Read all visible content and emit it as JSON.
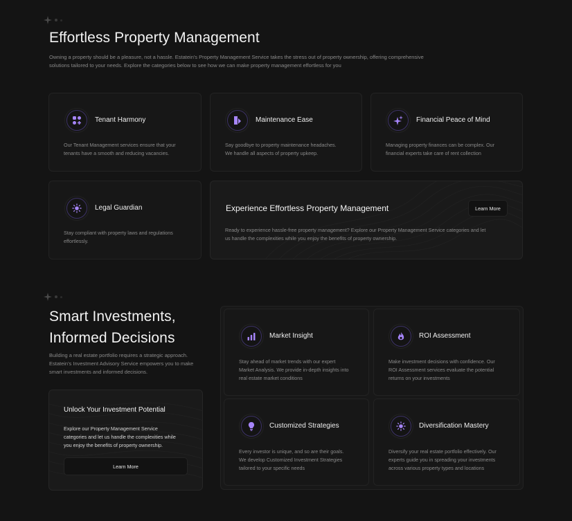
{
  "section1": {
    "title": "Effortless Property Management",
    "description_line1": "Owning a property should be a pleasure, not a hassle. Estatein's Property Management Service takes the stress out of property ownership, offering comprehensive",
    "description_line2": "solutions tailored to your needs. Explore the categories below to see how we can make property management effortless for you",
    "cards": [
      {
        "title": "Tenant Harmony",
        "icon": "tenant-icon",
        "text_line1": "Our Tenant Management services ensure that your",
        "text_line2": "tenants have a smooth and reducing vacancies."
      },
      {
        "title": "Maintenance Ease",
        "icon": "maintenance-icon",
        "text_line1": "Say goodbye to property maintenance headaches.",
        "text_line2": "We handle all aspects of property upkeep."
      },
      {
        "title": "Financial Peace of Mind",
        "icon": "sparkles-icon",
        "text_line1": "Managing property finances can be complex. Our",
        "text_line2": "financial experts take care of rent collection"
      },
      {
        "title": "Legal Guardian",
        "icon": "sun-icon",
        "text_line1": "Stay compliant with property laws and regulations",
        "text_line2": "effortlessly."
      }
    ],
    "cta": {
      "title": "Experience Effortless Property Management",
      "button": "Learn More",
      "text_line1": "Ready to experience hassle-free property management? Explore our Property Management Service categories and let",
      "text_line2": "us handle the complexities while you enjoy the benefits of property ownership."
    }
  },
  "section2": {
    "title_line1": "Smart Investments,",
    "title_line2": "Informed Decisions",
    "description_line1": "Building a real estate portfolio requires a strategic approach.",
    "description_line2": "Estatein's Investment Advisory Service empowers you to make",
    "description_line3": "smart investments and informed decisions.",
    "cta": {
      "title": "Unlock Your Investment Potential",
      "text_line1": "Explore our Property Management Service",
      "text_line2": "categories and let us handle the complexities while",
      "text_line3": "you enjoy the benefits of property ownership.",
      "button": "Learn More"
    },
    "cards": [
      {
        "title": "Market Insight",
        "icon": "bar-chart-icon",
        "text_line1": "Stay ahead of market trends with our expert",
        "text_line2": "Market Analysis. We provide in-depth insights into",
        "text_line3": "real estate market conditions"
      },
      {
        "title": "ROI Assessment",
        "icon": "fire-icon",
        "text_line1": "Make investment decisions with confidence. Our",
        "text_line2": "ROI Assessment services evaluate the potential",
        "text_line3": "returns on your investments"
      },
      {
        "title": "Customized Strategies",
        "icon": "lightbulb-icon",
        "text_line1": "Every investor is unique, and so are their goals.",
        "text_line2": "We develop Customized Investment Strategies",
        "text_line3": "tailored to your specific needs"
      },
      {
        "title": "Diversification Mastery",
        "icon": "sun-icon",
        "text_line1": "Diversify your real estate portfolio effectively. Our",
        "text_line2": "experts guide you in spreading your investments",
        "text_line3": "across various property types and locations"
      }
    ]
  },
  "colors": {
    "background": "#141414",
    "card": "#171717",
    "accent": "#a685fa",
    "text_muted": "#8a8a8a"
  }
}
